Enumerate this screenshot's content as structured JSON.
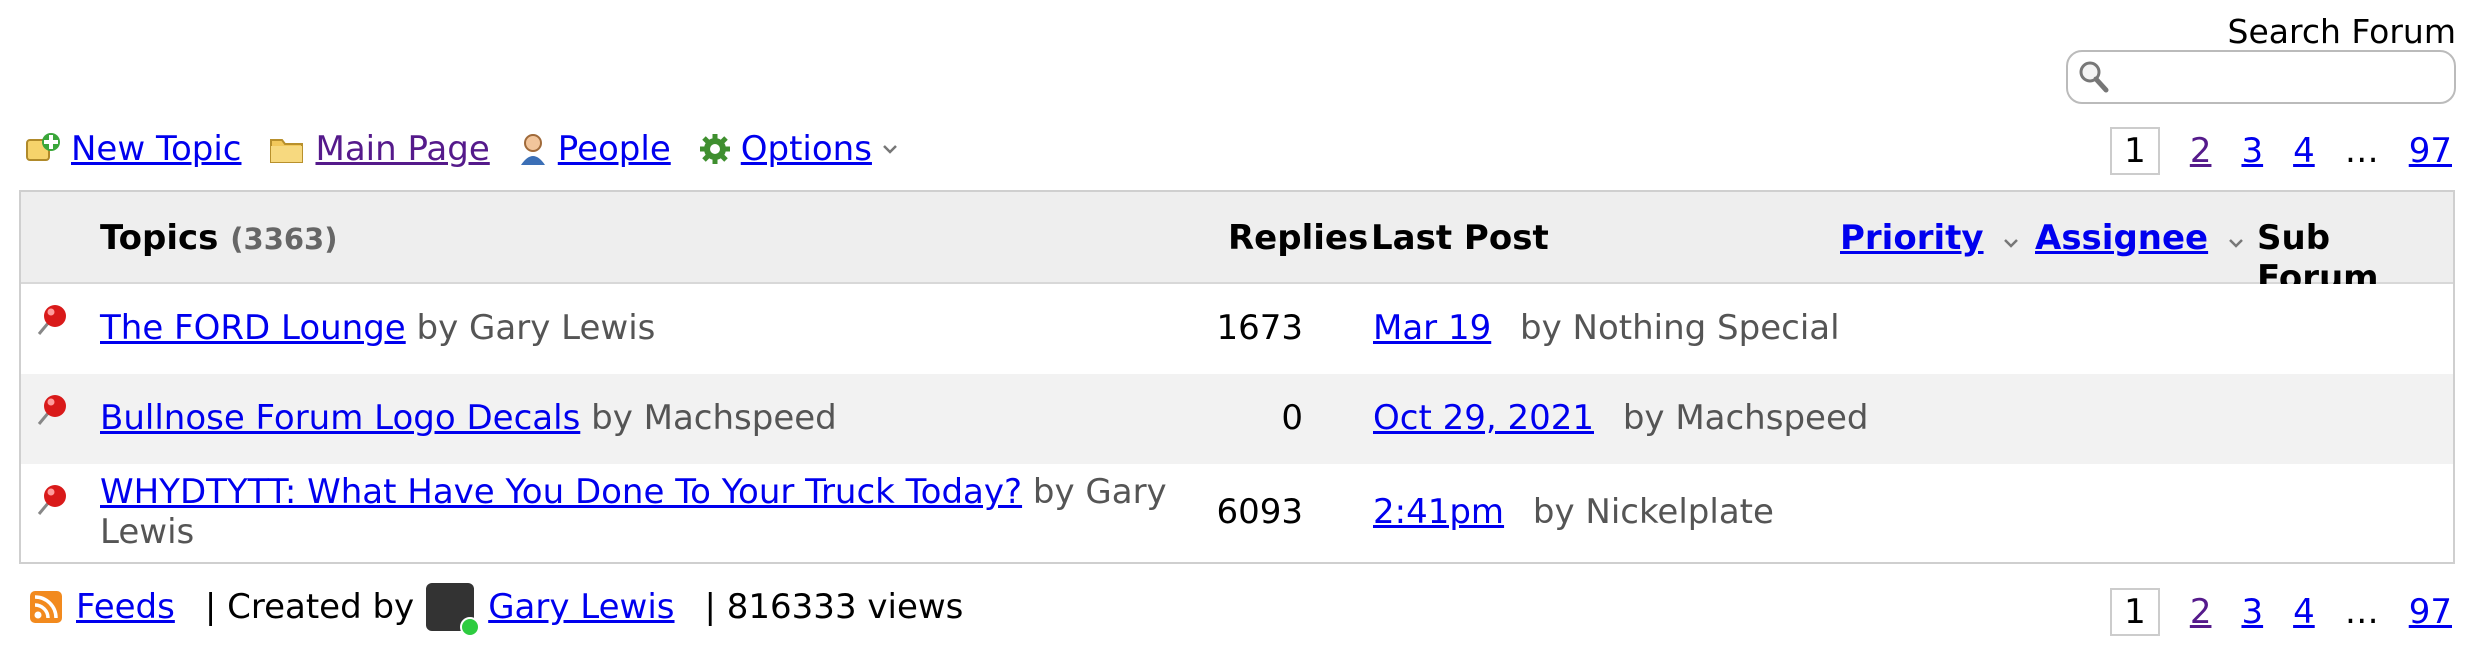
{
  "search": {
    "label": "Search Forum",
    "placeholder": ""
  },
  "toolbar": {
    "new_topic": "New Topic",
    "main_page": "Main Page",
    "people": "People",
    "options": "Options"
  },
  "pager": {
    "pages": [
      "1",
      "2",
      "3",
      "4"
    ],
    "ellipsis": "…",
    "last": "97",
    "current": "1"
  },
  "table": {
    "headers": {
      "topics": "Topics",
      "topics_count": "(3363)",
      "replies": "Replies",
      "last_post": "Last Post",
      "priority": "Priority",
      "assignee": "Assignee",
      "sub_forum": "Sub Forum"
    },
    "rows": [
      {
        "title": "The FORD Lounge",
        "author": "by Gary Lewis",
        "replies": "1673",
        "last_post_date": "Mar 19",
        "last_post_by": "by Nothing Special"
      },
      {
        "title": "Bullnose Forum Logo Decals",
        "author": "by Machspeed",
        "replies": "0",
        "last_post_date": "Oct 29, 2021",
        "last_post_by": "by Machspeed"
      },
      {
        "title": "WHYDTYTT: What Have You Done To Your Truck Today?",
        "author": "by Gary Lewis",
        "replies": "6093",
        "last_post_date": "2:41pm",
        "last_post_by": "by Nickelplate"
      }
    ]
  },
  "footer": {
    "feeds": "Feeds",
    "created_by_label": "| Created by",
    "creator": "Gary Lewis",
    "views": "| 816333 views"
  },
  "colors": {
    "link": "#0000ee",
    "visited": "#551a8b",
    "header_bg": "#eeeeee",
    "stripe_bg": "#f2f2f2"
  },
  "icons": [
    "search-icon",
    "new-topic-icon",
    "folder-icon",
    "person-icon",
    "gear-icon",
    "chevron-down-icon",
    "pin-icon",
    "rss-icon"
  ]
}
